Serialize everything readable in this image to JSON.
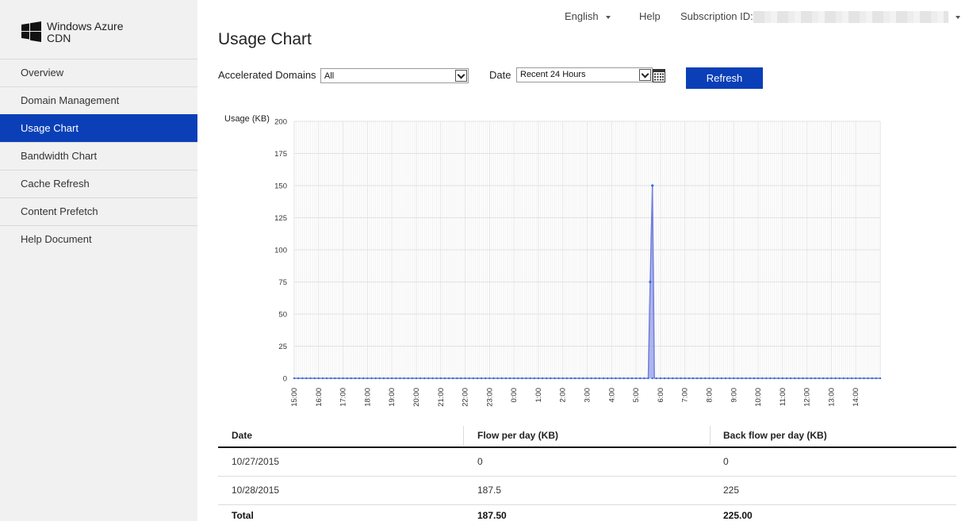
{
  "app": {
    "logo_line1": "Windows Azure",
    "logo_line2": "CDN",
    "accent_color": "#0a3fb8"
  },
  "sidebar": {
    "items": [
      {
        "label": "Overview",
        "active": false
      },
      {
        "label": "Domain Management",
        "active": false
      },
      {
        "label": "Usage Chart",
        "active": true
      },
      {
        "label": "Bandwidth Chart",
        "active": false
      },
      {
        "label": "Cache Refresh",
        "active": false
      },
      {
        "label": "Content Prefetch",
        "active": false
      },
      {
        "label": "Help Document",
        "active": false
      }
    ]
  },
  "topbar": {
    "language": "English",
    "help": "Help",
    "subscription_label": "Subscription ID:"
  },
  "main": {
    "title": "Usage Chart",
    "filters": {
      "domains_label": "Accelerated Domains",
      "domains_value": "All",
      "date_label": "Date",
      "date_value": "Recent 24 Hours",
      "refresh_label": "Refresh"
    }
  },
  "chart_data": {
    "type": "area",
    "ylabel": "Usage (KB)",
    "ylim": [
      0,
      200
    ],
    "yticks": [
      0,
      25,
      50,
      75,
      100,
      125,
      150,
      175,
      200
    ],
    "xticks": [
      "15:00",
      "16:00",
      "17:00",
      "18:00",
      "19:00",
      "20:00",
      "21:00",
      "22:00",
      "23:00",
      "0:00",
      "1:00",
      "2:00",
      "3:00",
      "4:00",
      "5:00",
      "6:00",
      "7:00",
      "8:00",
      "9:00",
      "10:00",
      "11:00",
      "12:00",
      "13:00",
      "14:00"
    ],
    "x_start_hour": 15,
    "x_end_hour": 39,
    "series": [
      {
        "color": "#6f7de0",
        "points": [
          [
            15.0,
            0
          ],
          [
            29.5,
            0
          ],
          [
            29.58,
            75
          ],
          [
            29.67,
            150
          ],
          [
            29.75,
            0
          ],
          [
            39.0,
            0
          ]
        ]
      }
    ],
    "grid": true
  },
  "table": {
    "columns": [
      "Date",
      "Flow per day (KB)",
      "Back flow per day (KB)"
    ],
    "rows": [
      [
        "10/27/2015",
        "0",
        "0"
      ],
      [
        "10/28/2015",
        "187.5",
        "225"
      ]
    ],
    "total": [
      "Total",
      "187.50",
      "225.00"
    ]
  }
}
